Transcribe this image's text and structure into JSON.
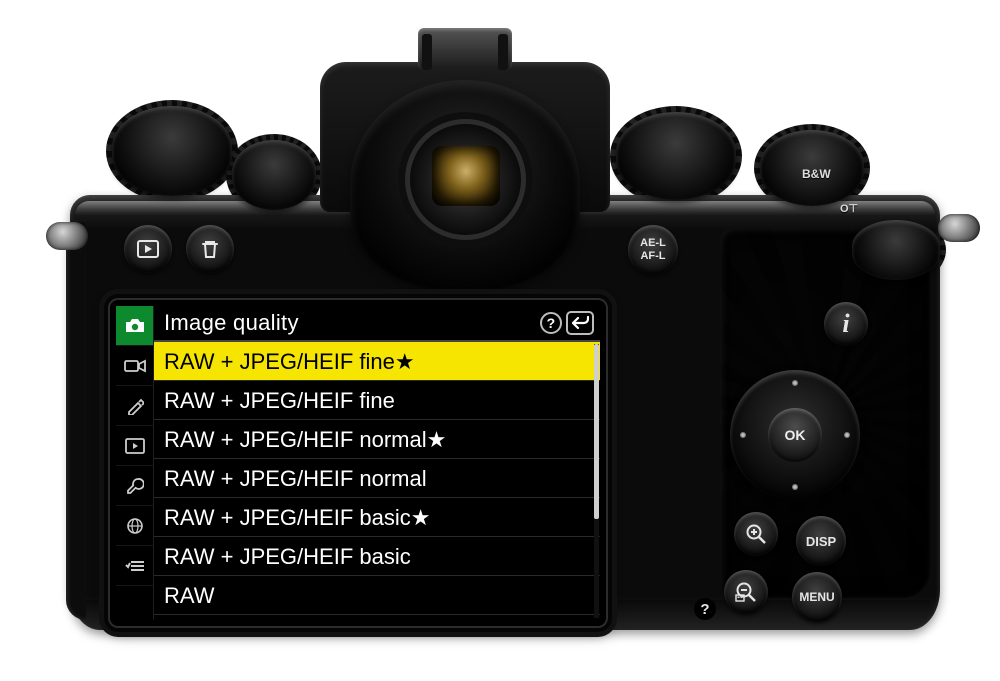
{
  "top_labels": {
    "bw": "B&W",
    "lock": "O⊤"
  },
  "buttons": {
    "ael": "AE-L\nAF-L",
    "info_i": "i",
    "disp": "DISP",
    "menu": "MENU",
    "ok": "OK",
    "help": "?"
  },
  "lcd": {
    "header": {
      "title": "Image quality",
      "help": "?",
      "back": "↩"
    },
    "side_tabs": [
      {
        "id": "photo",
        "glyph": "camera",
        "active": true
      },
      {
        "id": "video",
        "glyph": "video",
        "active": false
      },
      {
        "id": "custom",
        "glyph": "pencil",
        "active": false
      },
      {
        "id": "playback",
        "glyph": "play",
        "active": false
      },
      {
        "id": "setup",
        "glyph": "wrench",
        "active": false
      },
      {
        "id": "network",
        "glyph": "globe",
        "active": false
      },
      {
        "id": "mymenu",
        "glyph": "list",
        "active": false
      }
    ],
    "items": [
      {
        "label": "RAW + JPEG/HEIF fine★",
        "selected": true
      },
      {
        "label": "RAW + JPEG/HEIF fine",
        "selected": false
      },
      {
        "label": "RAW + JPEG/HEIF normal★",
        "selected": false
      },
      {
        "label": "RAW + JPEG/HEIF normal",
        "selected": false
      },
      {
        "label": "RAW + JPEG/HEIF basic★",
        "selected": false
      },
      {
        "label": "RAW + JPEG/HEIF basic",
        "selected": false
      },
      {
        "label": "RAW",
        "selected": false
      }
    ]
  }
}
